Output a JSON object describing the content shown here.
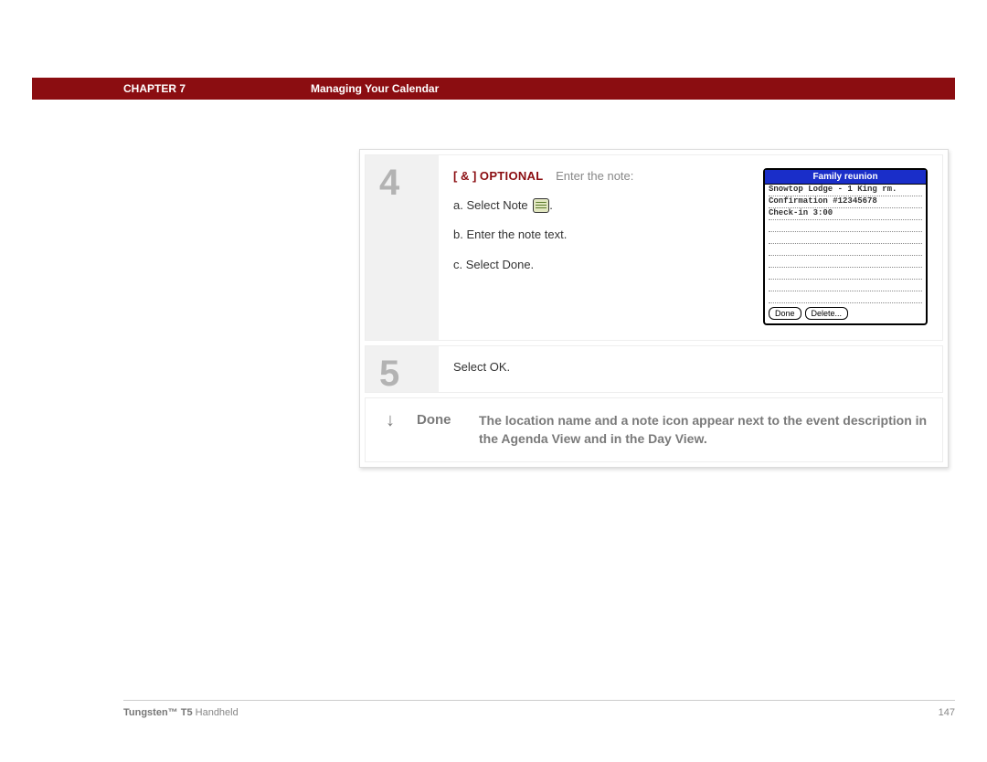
{
  "header": {
    "chapter_label": "CHAPTER 7",
    "title": "Managing Your Calendar"
  },
  "steps": {
    "four": {
      "number": "4",
      "tag_brackets": "[ & ]",
      "tag_optional": "OPTIONAL",
      "intro_after": "Enter the note:",
      "a": "a.  Select Note",
      "b": "b.  Enter the note text.",
      "c": "c.  Select Done."
    },
    "five": {
      "number": "5",
      "text": "Select OK."
    }
  },
  "handheld": {
    "title": "Family reunion",
    "line1": "Snowtop Lodge - 1 King rm.",
    "line2": "Confirmation #12345678",
    "line3": "Check-in 3:00",
    "done_btn": "Done",
    "delete_btn": "Delete..."
  },
  "done": {
    "arrow": "↓",
    "label": "Done",
    "text": "The location name and a note icon appear next to the event description in the Agenda View and in the Day View."
  },
  "footer": {
    "product_bold": "Tungsten™ T5",
    "product_rest": " Handheld",
    "page_number": "147"
  }
}
